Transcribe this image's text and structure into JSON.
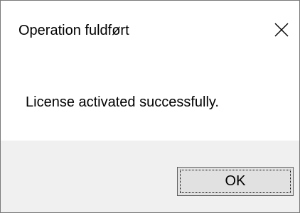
{
  "window": {
    "title": "Operation fuldført",
    "close_icon": "close-icon"
  },
  "content": {
    "message": "License activated successfully."
  },
  "buttons": {
    "ok_label": "OK"
  },
  "colors": {
    "background": "#ffffff",
    "button_bar": "#f0f0f0",
    "button_face": "#e1e1e1",
    "button_border_focus": "#0078d7",
    "window_border": "#7a7a7a"
  }
}
